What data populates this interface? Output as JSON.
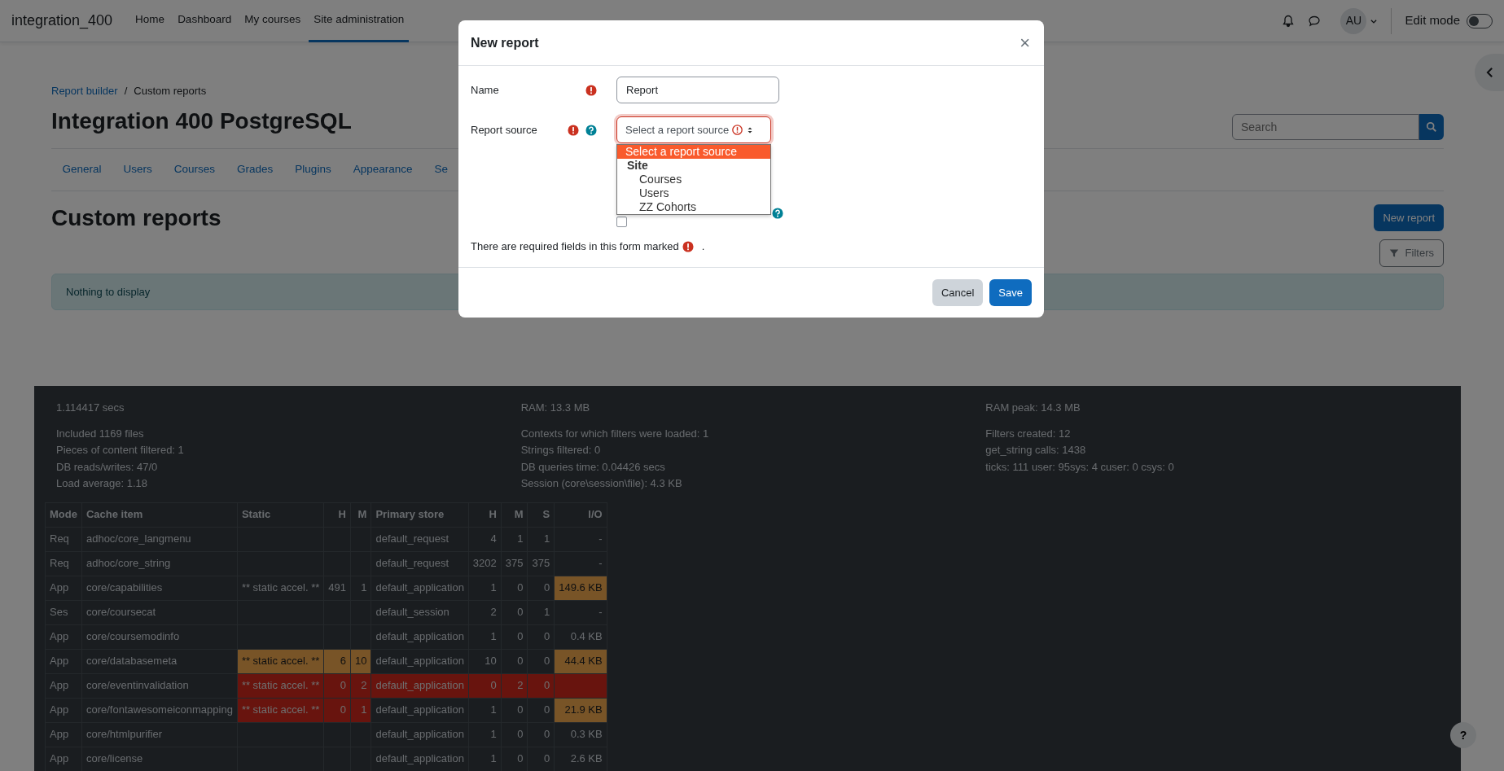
{
  "navbar": {
    "brand": "integration_400",
    "links": [
      {
        "label": "Home",
        "selected": false
      },
      {
        "label": "Dashboard",
        "selected": false
      },
      {
        "label": "My courses",
        "selected": false
      },
      {
        "label": "Site administration",
        "selected": true
      }
    ],
    "avatar": "AU",
    "edit_mode": {
      "label": "Edit mode",
      "on": false
    }
  },
  "breadcrumb": {
    "separator": "/",
    "items": [
      {
        "label": "Report builder",
        "link": true
      },
      {
        "label": "Custom reports",
        "link": false
      }
    ]
  },
  "page_title": "Integration 400 PostgreSQL",
  "search": {
    "placeholder": "Search"
  },
  "tabs": [
    "General",
    "Users",
    "Courses",
    "Grades",
    "Plugins",
    "Appearance",
    "Se"
  ],
  "heading": "Custom reports",
  "new_report_button": "New report",
  "filters_button": "Filters",
  "alert": "Nothing to display",
  "modal": {
    "title": "New report",
    "close": "×",
    "fields": [
      {
        "kind": "text",
        "label": "Name",
        "required": true,
        "help": false,
        "value": "Report",
        "invalid": false
      },
      {
        "kind": "select",
        "label": "Report source",
        "required": true,
        "help": true,
        "value": "Select a report source",
        "invalid": true
      }
    ],
    "options": [
      {
        "kind": "option",
        "label": "Select a report source",
        "selected": true
      },
      {
        "kind": "group",
        "label": "Site",
        "children": [
          {
            "label": "Courses",
            "selected": false
          },
          {
            "label": "Users",
            "selected": false
          },
          {
            "label": "ZZ Cohorts",
            "selected": false
          }
        ]
      }
    ],
    "checkbox": {
      "checked": false
    },
    "required_note": "There are required fields in this form marked",
    "note_end": ".",
    "buttons": [
      {
        "kind": "secondary",
        "label": "Cancel"
      },
      {
        "kind": "primary",
        "label": "Save"
      }
    ]
  },
  "perf": [
    {
      "head": "1.114417 secs",
      "lines": [
        "Included 1169 files",
        "Pieces of content filtered: 1",
        "DB reads/writes: 47/0",
        "Load average: 1.18"
      ]
    },
    {
      "head": "RAM: 13.3 MB",
      "lines": [
        "Contexts for which filters were loaded: 1",
        "Strings filtered: 0",
        "DB queries time: 0.04426 secs",
        "Session (core\\session\\file): 4.3 KB"
      ]
    },
    {
      "head": "RAM peak: 14.3 MB",
      "lines": [
        "Filters created: 12",
        "get_string calls: 1438",
        "ticks: 111 user: 95sys: 4 cuser: 0 csys: 0"
      ]
    }
  ],
  "cache_table": {
    "columns": [
      "Mode",
      "Cache item",
      "Static",
      "H",
      "M",
      "Primary store",
      "H",
      "M",
      "S",
      "I/O"
    ],
    "rows": [
      {
        "mode": "Req",
        "item": "adhoc/core_langmenu",
        "static_warning": false,
        "static_error": false,
        "store": "default_request",
        "store_h": "4",
        "store_m": "1",
        "store_s": "1",
        "store_warning": false,
        "store_error": false,
        "io": "-",
        "io_warning": false,
        "io_error": false
      },
      {
        "mode": "Req",
        "item": "adhoc/core_string",
        "static_warning": false,
        "static_error": false,
        "store": "default_request",
        "store_h": "3202",
        "store_m": "375",
        "store_s": "375",
        "store_warning": false,
        "store_error": false,
        "io": "-",
        "io_warning": false,
        "io_error": false
      },
      {
        "mode": "App",
        "item": "core/capabilities",
        "static": "** static accel. **",
        "static_h": "491",
        "static_m": "1",
        "static_warning": false,
        "static_error": false,
        "store": "default_application",
        "store_h": "1",
        "store_m": "0",
        "store_s": "0",
        "store_warning": false,
        "store_error": false,
        "io": "149.6 KB",
        "io_warning": true,
        "io_error": false
      },
      {
        "mode": "Ses",
        "item": "core/coursecat",
        "static_warning": false,
        "static_error": false,
        "store": "default_session",
        "store_h": "2",
        "store_m": "0",
        "store_s": "1",
        "store_warning": false,
        "store_error": false,
        "io": "-",
        "io_warning": false,
        "io_error": false
      },
      {
        "mode": "App",
        "item": "core/coursemodinfo",
        "static_warning": false,
        "static_error": false,
        "store": "default_application",
        "store_h": "1",
        "store_m": "0",
        "store_s": "0",
        "store_warning": false,
        "store_error": false,
        "io": "0.4 KB",
        "io_warning": false,
        "io_error": false
      },
      {
        "mode": "App",
        "item": "core/databasemeta",
        "static": "** static accel. **",
        "static_h": "6",
        "static_m": "10",
        "static_warning": true,
        "static_error": false,
        "store": "default_application",
        "store_h": "10",
        "store_m": "0",
        "store_s": "0",
        "store_warning": false,
        "store_error": false,
        "io": "44.4 KB",
        "io_warning": true,
        "io_error": false
      },
      {
        "mode": "App",
        "item": "core/eventinvalidation",
        "static": "** static accel. **",
        "static_h": "0",
        "static_m": "2",
        "static_warning": false,
        "static_error": true,
        "store": "default_application",
        "store_h": "0",
        "store_m": "2",
        "store_s": "0",
        "store_warning": false,
        "store_error": true,
        "io_warning": false,
        "io_error": true
      },
      {
        "mode": "App",
        "item": "core/fontawesomeiconmapping",
        "static": "** static accel. **",
        "static_h": "0",
        "static_m": "1",
        "static_warning": false,
        "static_error": true,
        "store": "default_application",
        "store_h": "1",
        "store_m": "0",
        "store_s": "0",
        "store_warning": false,
        "store_error": false,
        "io": "21.9 KB",
        "io_warning": true,
        "io_error": false
      },
      {
        "mode": "App",
        "item": "core/htmlpurifier",
        "static_warning": false,
        "static_error": false,
        "store": "default_application",
        "store_h": "1",
        "store_m": "0",
        "store_s": "0",
        "store_warning": false,
        "store_error": false,
        "io": "0.3 KB",
        "io_warning": false,
        "io_error": false
      },
      {
        "mode": "App",
        "item": "core/license",
        "static_warning": false,
        "static_error": false,
        "store": "default_application",
        "store_h": "1",
        "store_m": "0",
        "store_s": "0",
        "store_warning": false,
        "store_error": false,
        "io": "2.6 KB",
        "io_warning": false,
        "io_error": false
      }
    ]
  },
  "help_button": "?"
}
